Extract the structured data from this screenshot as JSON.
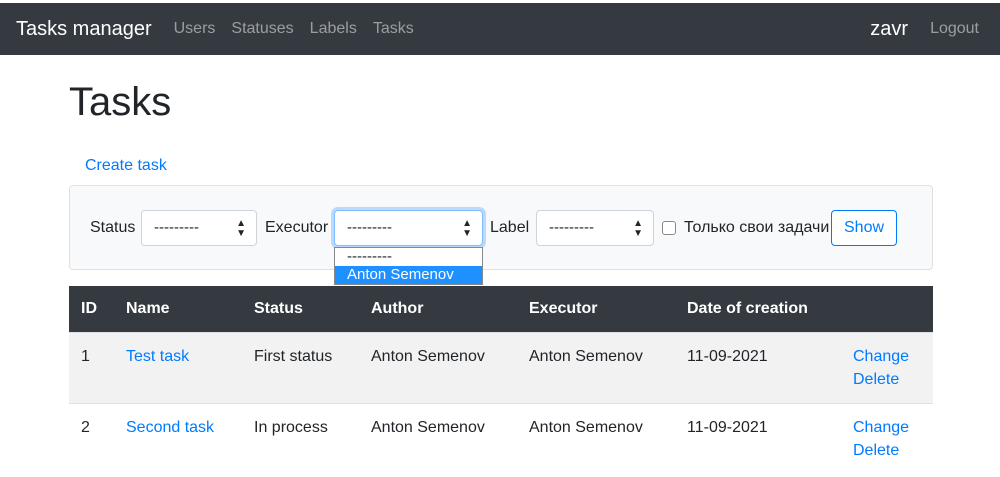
{
  "nav": {
    "brand": "Tasks manager",
    "links": [
      "Users",
      "Statuses",
      "Labels",
      "Tasks"
    ],
    "user": "zavr",
    "logout": "Logout"
  },
  "page": {
    "title": "Tasks",
    "create": "Create task"
  },
  "filter": {
    "status_label": "Status",
    "status_value": "---------",
    "executor_label": "Executor",
    "executor_value": "---------",
    "executor_options": [
      "---------",
      "Anton Semenov"
    ],
    "label_label": "Label",
    "label_value": "---------",
    "own_label": "Только свои задачи",
    "show": "Show"
  },
  "table": {
    "headers": [
      "ID",
      "Name",
      "Status",
      "Author",
      "Executor",
      "Date of creation",
      ""
    ],
    "rows": [
      {
        "id": "1",
        "name": "Test task",
        "status": "First status",
        "author": "Anton Semenov",
        "executor": "Anton Semenov",
        "date": "11-09-2021",
        "change": "Change",
        "delete": "Delete"
      },
      {
        "id": "2",
        "name": "Second task",
        "status": "In process",
        "author": "Anton Semenov",
        "executor": "Anton Semenov",
        "date": "11-09-2021",
        "change": "Change",
        "delete": "Delete"
      }
    ]
  }
}
